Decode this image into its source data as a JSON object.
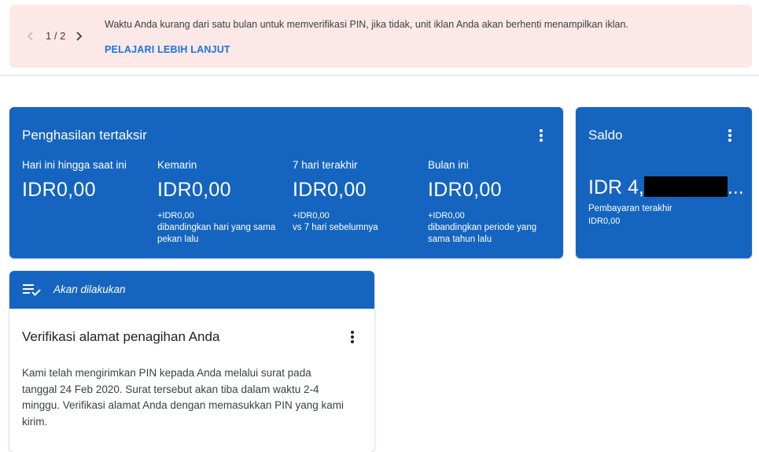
{
  "banner": {
    "pager": "1 / 2",
    "message": "Waktu Anda kurang dari satu bulan untuk memverifikasi PIN, jika tidak, unit iklan Anda akan berhenti menampilkan iklan.",
    "link": "PELAJARI LEBIH LANJUT"
  },
  "earnings": {
    "title": "Penghasilan tertaksir",
    "metrics": [
      {
        "label": "Hari ini hingga saat ini",
        "value": "IDR0,00",
        "delta": "",
        "compare": ""
      },
      {
        "label": "Kemarin",
        "value": "IDR0,00",
        "delta": "+IDR0,00",
        "compare": "dibandingkan hari yang sama pekan lalu"
      },
      {
        "label": "7 hari terakhir",
        "value": "IDR0,00",
        "delta": "+IDR0,00",
        "compare": "vs 7 hari sebelumnya"
      },
      {
        "label": "Bulan ini",
        "value": "IDR0,00",
        "delta": "+IDR0,00",
        "compare": "dibandingkan periode yang sama tahun lalu"
      }
    ]
  },
  "balance": {
    "title": "Saldo",
    "value_prefix": "IDR 4,",
    "value_suffix": "...",
    "caption": "Pembayaran terakhir",
    "last_amount": "IDR0,00"
  },
  "todo": {
    "header": "Akan dilakukan",
    "task_title": "Verifikasi alamat penagihan Anda",
    "task_body": "Kami telah mengirimkan PIN kepada Anda melalui surat pada tanggal 24 Feb 2020. Surat tersebut akan tiba dalam waktu 2-4 minggu. Verifikasi alamat Anda dengan memasukkan PIN yang kami kirim."
  },
  "colors": {
    "banner_bg": "#fce8e6",
    "card_blue": "#1565c0",
    "link_blue": "#1a73e8"
  },
  "icons": [
    "chevron-left-icon",
    "chevron-right-icon",
    "more-vert-icon",
    "playlist-check-icon"
  ]
}
